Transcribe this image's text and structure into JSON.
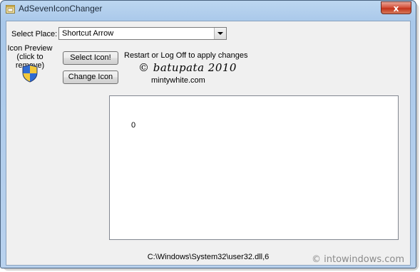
{
  "window": {
    "title": "AdSevenIconChanger",
    "close_label": "x"
  },
  "form": {
    "select_place_label": "Select Place:",
    "place_value": "Shortcut Arrow",
    "icon_preview_label_line1": "Icon Preview",
    "icon_preview_label_line2": "(click to remove)",
    "select_icon_button": "Select Icon!",
    "change_icon_button": "Change Icon",
    "restart_note": "Restart or Log Off to apply changes",
    "copyright": "© batupata 2010",
    "website": "mintywhite.com",
    "output_value": "0",
    "status_path": "C:\\Windows\\System32\\user32.dll,6"
  },
  "watermark": "© intowindows.com",
  "icons": {
    "app": "app-window-icon",
    "preview": "uac-shield-icon",
    "close": "close-icon",
    "dropdown": "chevron-down-icon"
  },
  "colors": {
    "frame": "#a9c8ea",
    "close": "#c2331b",
    "client": "#f0f0f0"
  }
}
